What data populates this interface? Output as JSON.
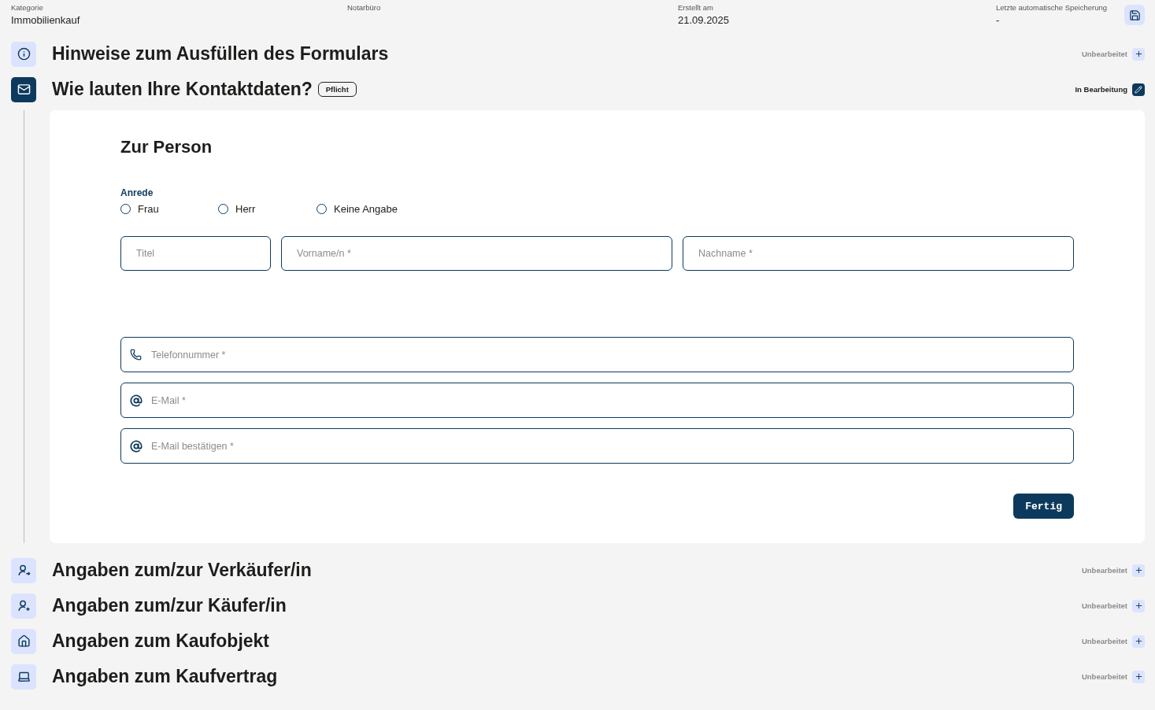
{
  "header": [
    {
      "label": "Kategorie",
      "value": "Immobilienkauf"
    },
    {
      "label": "Notarbüro"
    },
    {
      "label": "Erstellt am",
      "value": "21.09.2025"
    },
    {
      "label": "Letzte automatische Speicherung",
      "value": "-"
    }
  ],
  "sections": [
    {
      "kind": "info",
      "title": "Hinweise zum Ausfüllen des Formulars",
      "expanded": false,
      "status": {
        "kind": "untouched",
        "label": "Unbearbeitet"
      }
    },
    {
      "kind": "contact",
      "title": "Wie lauten Ihre Kontaktdaten?",
      "badge": "Pflicht",
      "expanded": true,
      "status": {
        "kind": "editing",
        "label": "In Bearbeitung"
      },
      "form": {
        "heading": "Zur Person",
        "salutation": {
          "label": "Anrede",
          "options": [
            {
              "label": "Frau",
              "selected": false
            },
            {
              "label": "Herr",
              "selected": false
            },
            {
              "label": "Keine Angabe",
              "selected": false
            }
          ]
        },
        "name_fields": [
          {
            "placeholder": "Titel",
            "kind": "short"
          },
          {
            "placeholder": "Vorname/n *",
            "kind": "wide"
          },
          {
            "placeholder": "Nachname *",
            "kind": "wide"
          }
        ],
        "contact_fields": [
          {
            "placeholder": "Telefonnummer *",
            "kind": "phone"
          },
          {
            "placeholder": "E-Mail *",
            "kind": "email"
          },
          {
            "placeholder": "E-Mail bestätigen *",
            "kind": "email"
          }
        ],
        "submit": "Fertig"
      }
    },
    {
      "kind": "seller",
      "title": "Angaben zum/zur Verkäufer/in",
      "expanded": false,
      "status": {
        "kind": "untouched",
        "label": "Unbearbeitet"
      }
    },
    {
      "kind": "buyer",
      "title": "Angaben zum/zur Käufer/in",
      "expanded": false,
      "status": {
        "kind": "untouched",
        "label": "Unbearbeitet"
      }
    },
    {
      "kind": "property",
      "title": "Angaben zum Kaufobjekt",
      "expanded": false,
      "status": {
        "kind": "untouched",
        "label": "Unbearbeitet"
      }
    },
    {
      "kind": "contract",
      "title": "Angaben zum Kaufvertrag",
      "expanded": false,
      "status": {
        "kind": "untouched",
        "label": "Unbearbeitet"
      }
    }
  ]
}
